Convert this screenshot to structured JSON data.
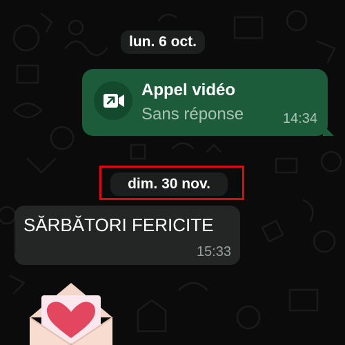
{
  "conversation": {
    "date_separators": [
      {
        "label": "lun. 6 oct."
      },
      {
        "label": "dim. 30 nov."
      }
    ],
    "call_message": {
      "title": "Appel vidéo",
      "status": "Sans réponse",
      "time": "14:34",
      "icon": "video-call-missed-icon",
      "direction": "outgoing"
    },
    "text_message": {
      "text": "SĂRBĂTORI FERICITE",
      "time": "15:33",
      "direction": "incoming"
    },
    "sticker": {
      "icon": "love-letter-envelope-icon"
    }
  },
  "annotation": {
    "highlight_color": "#d90c14"
  },
  "colors": {
    "background": "#0b0b0b",
    "outgoing_bubble": "#1c5c3b",
    "incoming_bubble": "#242626",
    "date_pill": "#1d1f1f"
  }
}
